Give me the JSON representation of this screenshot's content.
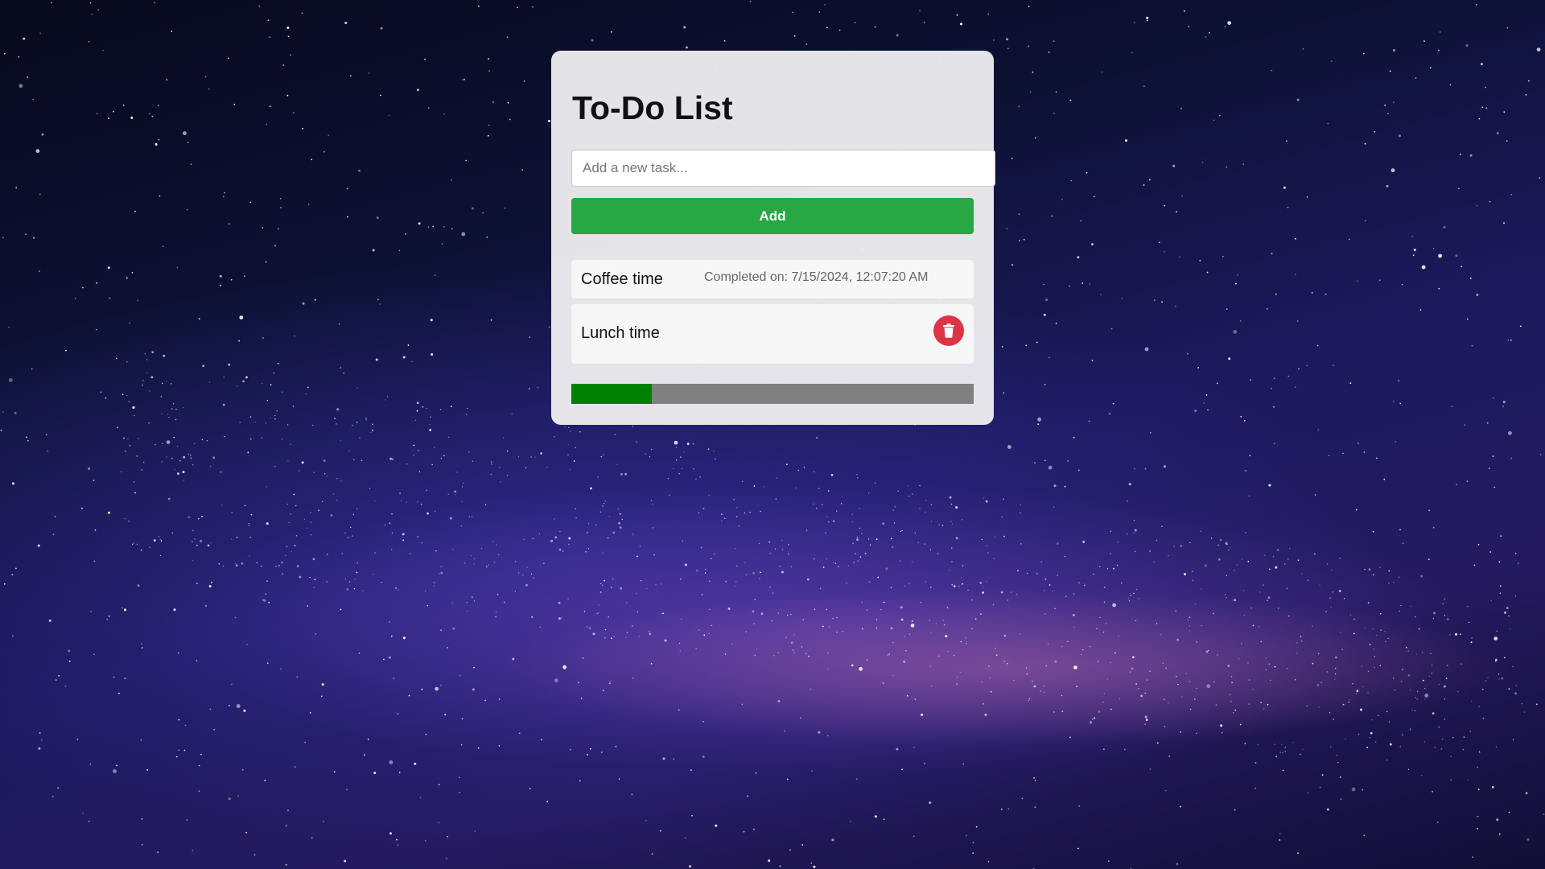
{
  "app": {
    "title": "To-Do List"
  },
  "input": {
    "placeholder": "Add a new task...",
    "value": ""
  },
  "add_button": {
    "label": "Add"
  },
  "tasks": [
    {
      "name": "Coffee time",
      "completed": true,
      "completed_text": "Completed on: 7/15/2024, 12:07:20 AM"
    },
    {
      "name": "Lunch time",
      "completed": false,
      "delete_icon": "trash-icon"
    }
  ],
  "progress": {
    "fraction": 0.2
  },
  "colors": {
    "add_button": "#28a745",
    "delete_button": "#dc3545",
    "progress_fill": "#008000",
    "progress_track": "#808080",
    "card_background": "#ebebee"
  }
}
